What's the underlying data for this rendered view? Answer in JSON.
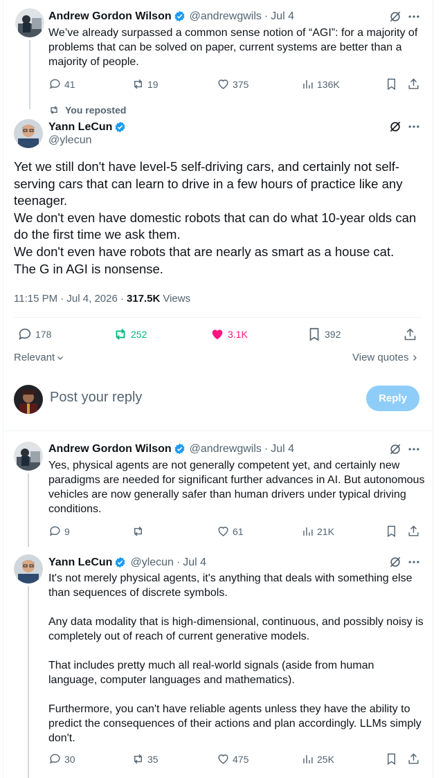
{
  "tweet1": {
    "name": "Andrew Gordon Wilson",
    "handle": "@andrewgwils",
    "sep": "·",
    "date": "Jul 4",
    "text": "We’ve already surpassed a common sense notion of “AGI”: for a majority of problems that can be solved on paper, current systems are better than a majority of people.",
    "replies": "41",
    "reposts": "19",
    "likes": "375",
    "views": "136K"
  },
  "repost_banner": "You reposted",
  "main_tweet": {
    "name": "Yann LeCun",
    "handle": "@ylecun",
    "lines": [
      "Yet we still don't have level-5 self-driving cars, and certainly not self-serving cars that can learn to drive in a few hours of practice like any teenager.",
      "We don't even have domestic robots that can do what 10-year olds can do the first time we ask them.",
      "We don't even have robots that are nearly as smart as a house cat.",
      "The G in AGI is nonsense."
    ],
    "timestamp": "11:15 PM · Jul 4, 2026 ·",
    "views_count": "317.5K",
    "views_label": "Views",
    "replies": "178",
    "reposts": "252",
    "likes": "3.1K",
    "bookmarks": "392"
  },
  "sort_label": "Relevant",
  "view_quotes": "View quotes",
  "reply_box": {
    "placeholder": "Post your reply",
    "button": "Reply"
  },
  "reply1": {
    "name": "Andrew Gordon Wilson",
    "handle": "@andrewgwils",
    "sep": "·",
    "date": "Jul 4",
    "text": "Yes, physical agents are not generally competent yet, and certainly new paradigms are needed for significant further advances in AI. But autonomous vehicles are now generally safer than human drivers under typical driving conditions.",
    "replies": "9",
    "likes": "61",
    "views": "21K"
  },
  "reply2": {
    "name": "Yann LeCun",
    "handle": "@ylecun",
    "sep": "·",
    "date": "Jul 4",
    "paragraphs": [
      "It's not merely physical agents, it's anything that deals with something else than sequences of discrete symbols.",
      "Any data modality that is high-dimensional, continuous, and possibly noisy is completely out of reach of current generative models.",
      "That includes pretty much all real-world signals (aside from human language, computer languages and mathematics).",
      "Furthermore, you can't have reliable agents unless they have the ability to predict the consequences of their actions and plan accordingly. LLMs simply don't."
    ],
    "replies": "30",
    "reposts": "35",
    "likes": "475",
    "views": "25K"
  },
  "colors": {
    "text": "#0f1419",
    "secondary": "#536471",
    "verified": "#1d9bf0",
    "repost_active": "#00ba7c",
    "like_active": "#f91880",
    "reply_button_bg": "#8ecdf8"
  }
}
